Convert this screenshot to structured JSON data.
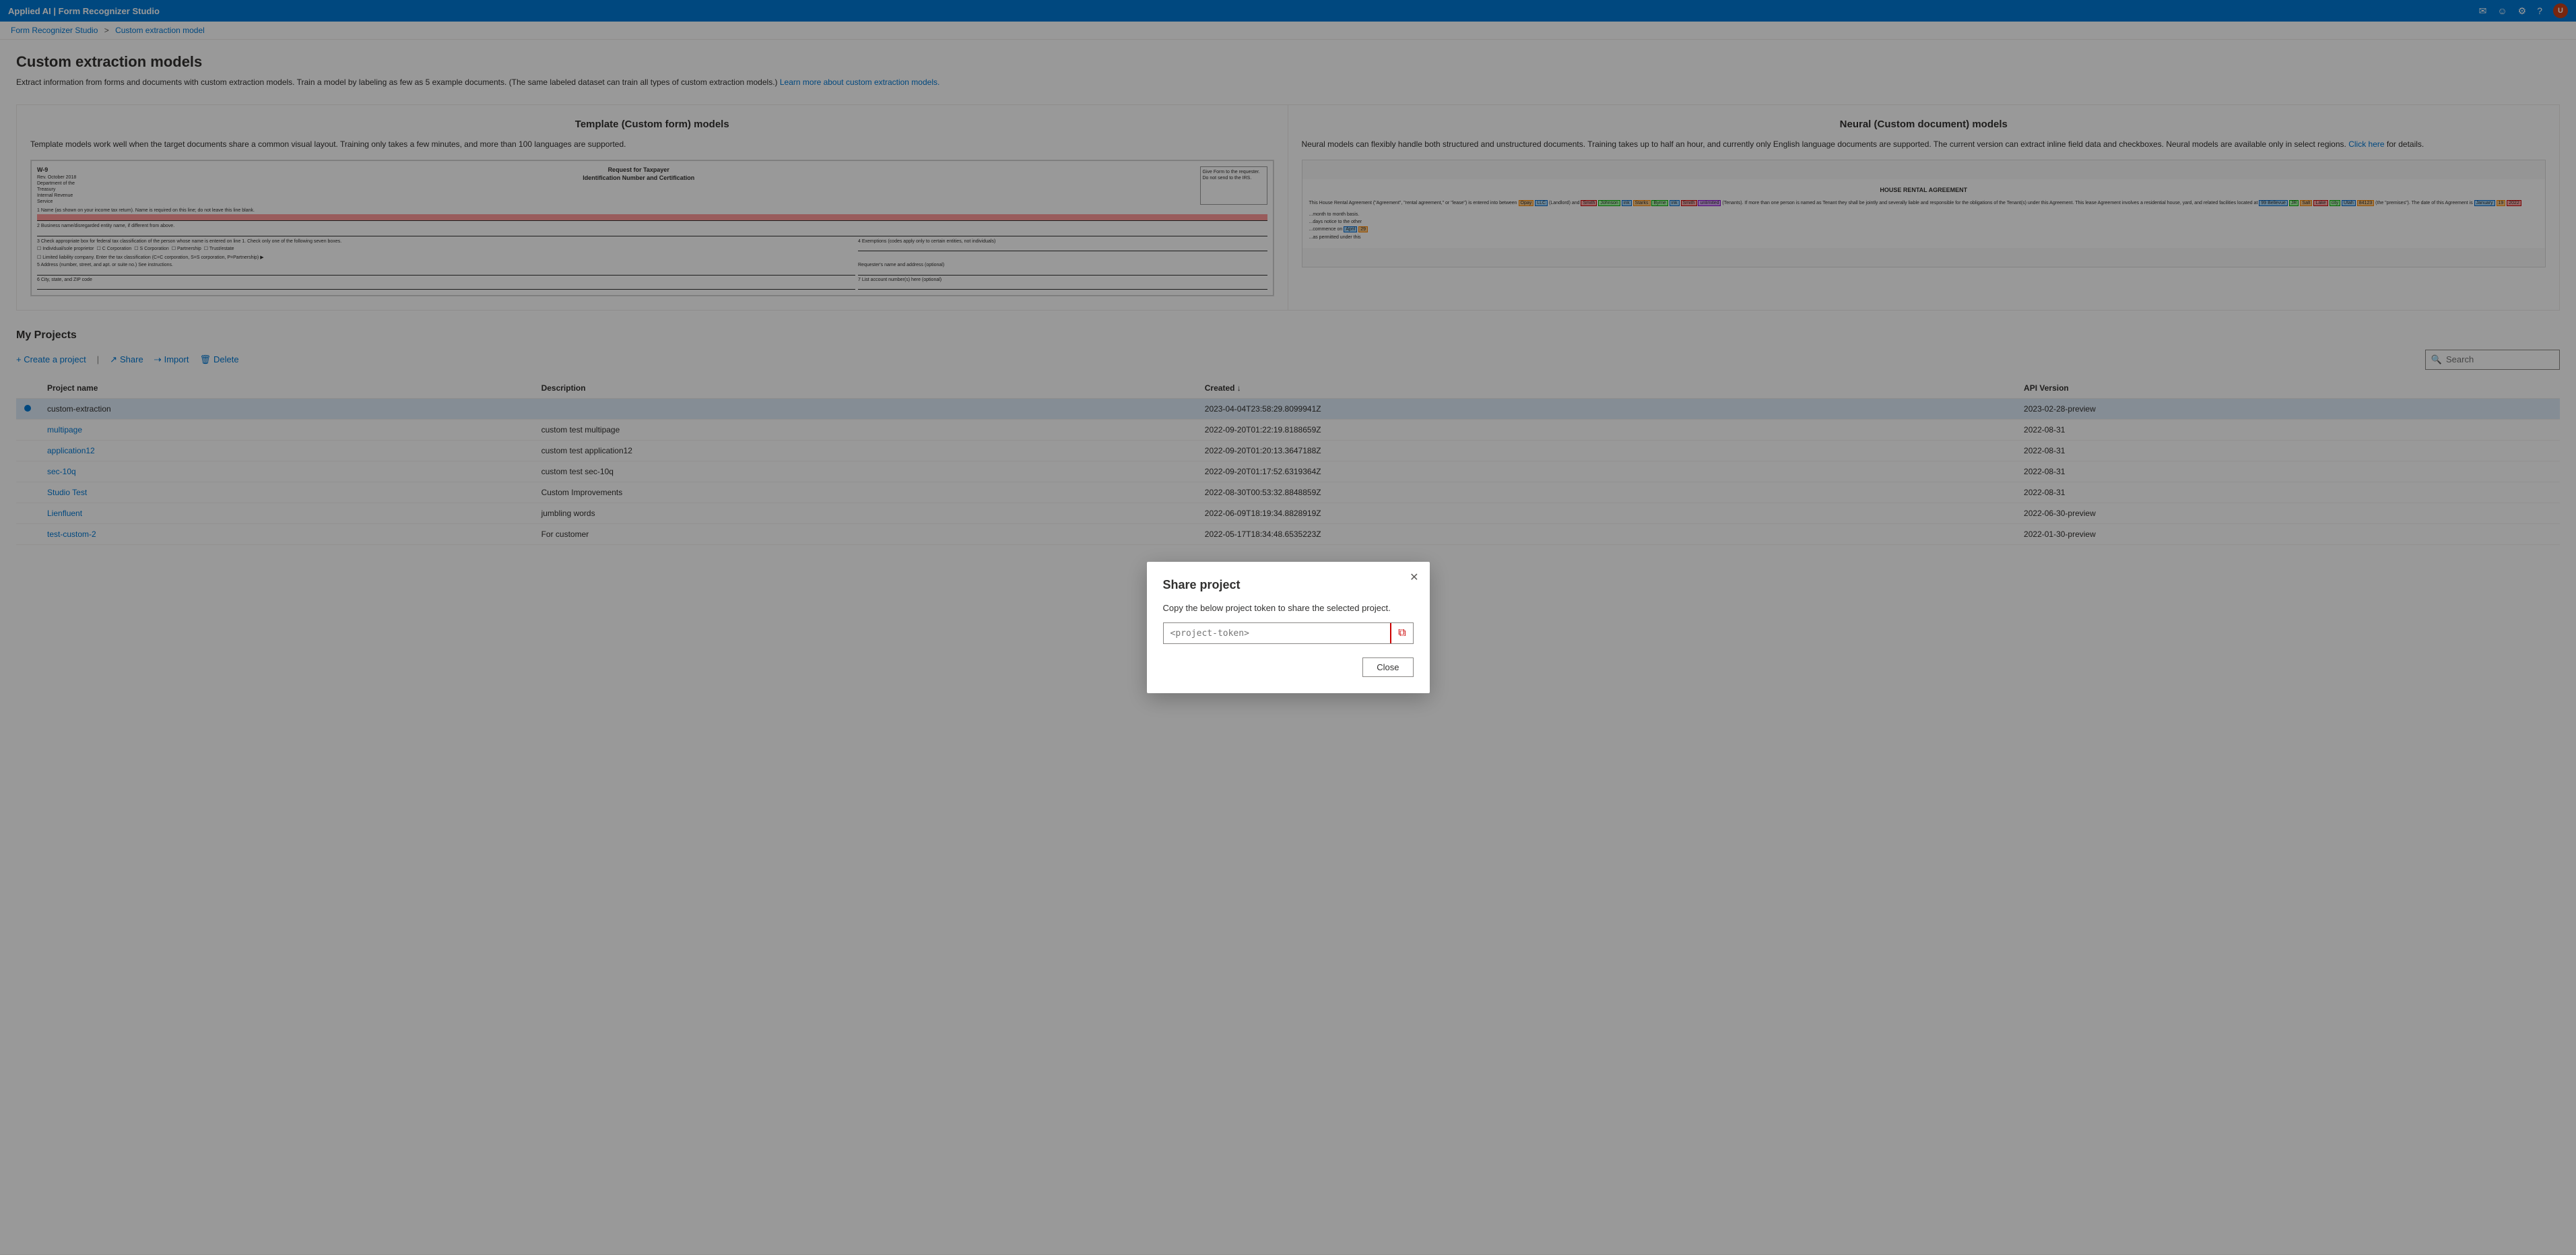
{
  "topbar": {
    "title": "Applied AI | Form Recognizer Studio",
    "icons": [
      "mail",
      "smiley",
      "settings",
      "help",
      "user"
    ],
    "user_initial": "U"
  },
  "breadcrumb": {
    "home": "Form Recognizer Studio",
    "separator": ">",
    "current": "Custom extraction model"
  },
  "page": {
    "title": "Custom extraction models",
    "description": "Extract information from forms and documents with custom extraction models. Train a model by labeling as few as 5 example documents. (The same labeled dataset can train all types of custom extraction models.)",
    "learn_more_link": "Learn more about custom extraction models."
  },
  "template_card": {
    "title": "Template (Custom form) models",
    "description": "Template models work well when the target documents share a common visual layout. Training only takes a few minutes, and more than 100 languages are supported."
  },
  "neural_card": {
    "title": "Neural (Custom document) models",
    "description": "Neural models can flexibly handle both structured and unstructured documents. Training takes up to half an hour, and currently only English language documents are supported. The current version can extract inline field data and checkboxes. Neural models are available only in select regions.",
    "click_here": "Click here",
    "details": "for details."
  },
  "projects_section": {
    "title": "My Projects",
    "create_label": "+ Create a project",
    "share_label": "Share",
    "import_label": "Import",
    "delete_label": "Delete",
    "search_placeholder": "Search"
  },
  "table": {
    "columns": [
      "",
      "Project name",
      "Description",
      "Created ↓",
      "API Version"
    ],
    "rows": [
      {
        "indicator": true,
        "name": "custom-extraction",
        "description": "",
        "created": "2023-04-04T23:58:29.8099941Z",
        "api_version": "2023-02-28-preview",
        "selected": true
      },
      {
        "indicator": false,
        "name": "multipage",
        "description": "custom test multipage",
        "created": "2022-09-20T01:22:19.8188659Z",
        "api_version": "2022-08-31",
        "selected": false
      },
      {
        "indicator": false,
        "name": "application12",
        "description": "custom test application12",
        "created": "2022-09-20T01:20:13.3647188Z",
        "api_version": "2022-08-31",
        "selected": false
      },
      {
        "indicator": false,
        "name": "sec-10q",
        "description": "custom test sec-10q",
        "created": "2022-09-20T01:17:52.6319364Z",
        "api_version": "2022-08-31",
        "selected": false
      },
      {
        "indicator": false,
        "name": "Studio Test",
        "description": "Custom Improvements",
        "created": "2022-08-30T00:53:32.8848859Z",
        "api_version": "2022-08-31",
        "selected": false
      },
      {
        "indicator": false,
        "name": "Lienfluent",
        "description": "jumbling words",
        "created": "2022-06-09T18:19:34.8828919Z",
        "api_version": "2022-06-30-preview",
        "selected": false
      },
      {
        "indicator": false,
        "name": "test-custom-2",
        "description": "For customer",
        "created": "2022-05-17T18:34:48.6535223Z",
        "api_version": "2022-01-30-preview",
        "selected": false
      }
    ]
  },
  "modal": {
    "title": "Share project",
    "description": "Copy the below project token to share the selected project.",
    "token_placeholder": "<project-token>",
    "close_button": "Close"
  },
  "colors": {
    "accent": "#0078d4",
    "topbar_bg": "#0078d4",
    "selected_row": "#deecf9",
    "copy_btn_border": "#cc0000"
  }
}
